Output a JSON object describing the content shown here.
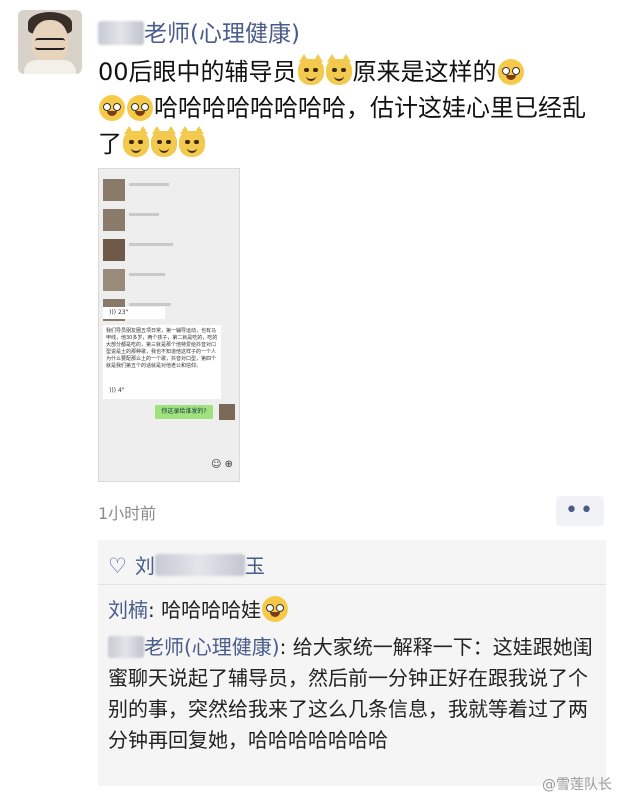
{
  "post": {
    "author_suffix": "老师(心理健康)",
    "text_a": "00后眼中的辅导员",
    "text_b": "原来是这样的",
    "text_c": "哈哈哈哈哈哈哈哈，估计这娃心里已经乱了",
    "time": "1小时前"
  },
  "screenshot": {
    "voice1": "23\"",
    "message": "我们导员朋友圈五项日常，第一辅导运动，也有马甲线，他30多岁，两个孩子，第二就是吃的，吃的大部分都是吃的，第三就是那个他特爱给抖音对口型说是土的那种歌，我也不知道他这样子的一个人为什么要配那么土的一个歌，抖音对口型，第四个就是我们第五个的话就是对他老公和信仰。",
    "voice2": "4\"",
    "reply": "你这录给谁发的?",
    "icons": "☺ ⊕"
  },
  "more_button": "••",
  "comments": {
    "likes_name": "刘",
    "likes_tail": "玉",
    "c1_name": "刘楠",
    "c1_text": ": 哈哈哈哈娃",
    "c2_name": "老师(心理健康)",
    "c2_text": ": 给大家统一解释一下：这娃跟她闺蜜聊天说起了辅导员，然后前一分钟正好在跟我说了个别的事，突然给我来了这么几条信息，我就等着过了两分钟再回复她，哈哈哈哈哈哈哈"
  },
  "watermark": "@雪莲队长"
}
